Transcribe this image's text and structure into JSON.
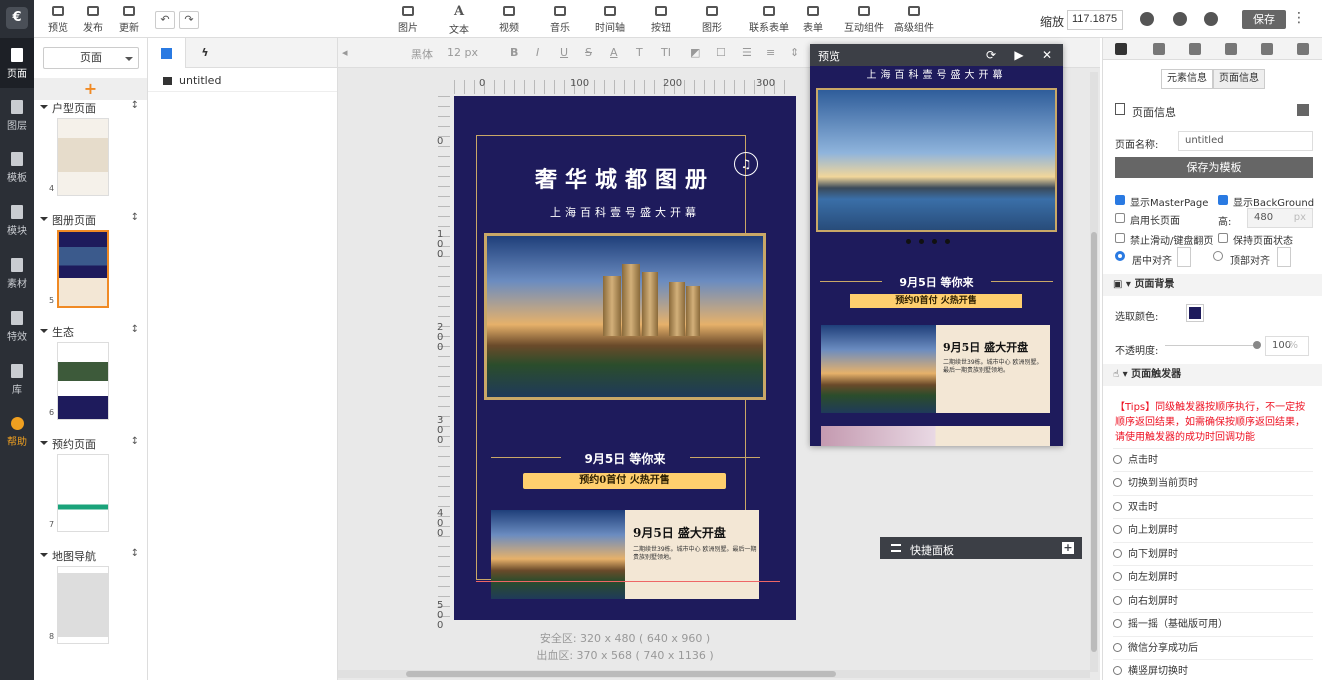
{
  "rail": {
    "logo": "€",
    "items": [
      {
        "label": "页面"
      },
      {
        "label": "图层"
      },
      {
        "label": "模板"
      },
      {
        "label": "模块"
      },
      {
        "label": "素材"
      },
      {
        "label": "特效"
      },
      {
        "label": "库"
      },
      {
        "label": "帮助"
      }
    ]
  },
  "toolbar": {
    "left": [
      {
        "label": "预览"
      },
      {
        "label": "发布"
      },
      {
        "label": "更新"
      }
    ],
    "center": [
      {
        "label": "图片"
      },
      {
        "label": "文本"
      },
      {
        "label": "视频"
      },
      {
        "label": "音乐"
      },
      {
        "label": "时间轴"
      },
      {
        "label": "按钮"
      },
      {
        "label": "图形"
      },
      {
        "label": "联系表单"
      },
      {
        "label": "表单"
      },
      {
        "label": "互动组件"
      },
      {
        "label": "高级组件"
      }
    ],
    "zoom_label": "缩放",
    "zoom_value": "117.1875",
    "save": "保存",
    "text_icon": "A"
  },
  "pages": {
    "select_value": "页面",
    "add": "+",
    "groups": [
      {
        "name": "户型页面",
        "num": "4"
      },
      {
        "name": "图册页面",
        "num": "5"
      },
      {
        "name": "生态",
        "num": "6"
      },
      {
        "name": "预约页面",
        "num": "7"
      },
      {
        "name": "地图导航",
        "num": "8"
      }
    ]
  },
  "layers": {
    "item": "untitled"
  },
  "format": {
    "font": "黑体",
    "size": "12 px",
    "items": [
      "B",
      "I",
      "U",
      "S",
      "A",
      "T",
      "TI"
    ]
  },
  "rulers": {
    "h": [
      "0",
      "100",
      "200",
      "300"
    ],
    "v": [
      "0",
      "1",
      "0",
      "0",
      "2",
      "0",
      "0",
      "3",
      "0",
      "0",
      "4",
      "0",
      "0",
      "5",
      "0",
      "0"
    ]
  },
  "poster": {
    "title": "奢华城都图册",
    "subtitle": "上海百科壹号盛大开幕",
    "music": "♫",
    "date": "9月5日 等你来",
    "pill": "预约0首付  火热开售",
    "card_title": "9月5日 盛大开盘",
    "card_desc": "二期续世39栋。城市中心 欧洲别墅。最后一期贵族别墅领地。"
  },
  "canvas": {
    "safe": "安全区: 320 x 480 ( 640 x 960 )",
    "bleed": "出血区: 370 x 568 ( 740 x 1136 )"
  },
  "preview": {
    "title": "预览",
    "top_text": "上海百科壹号盛大开幕",
    "date": "9月5日 等你来",
    "pill": "预约0首付  火热开售",
    "card_title": "9月5日 盛大开盘",
    "card_desc": "二期续世39栋。城市中心 欧洲别墅。最后一期贵族别墅领地。",
    "icons": [
      "⟳",
      "▶",
      "✕"
    ]
  },
  "quick_panel": {
    "label": "快捷面板",
    "plus": "+"
  },
  "props": {
    "sub_tabs": [
      "元素信息",
      "页面信息"
    ],
    "page_info": "页面信息",
    "name_label": "页面名称:",
    "name_value": "untitled",
    "save_template": "保存为模板",
    "show_master": "显示MasterPage",
    "show_bg": "显示BackGround",
    "long_page": "启用长页面",
    "height_label": "高:",
    "height_value": "480",
    "height_unit": "px",
    "disable_swipe": "禁止滑动/键盘翻页",
    "keep_state": "保持页面状态",
    "center_align": "居中对齐",
    "top_align": "顶部对齐",
    "bg_section": "页面背景",
    "pick_color": "选取颜色:",
    "bg_color": "#1e1b5c",
    "opacity_label": "不透明度:",
    "opacity_value": "100",
    "opacity_unit": "%",
    "trigger_section": "页面触发器",
    "tips": "【Tips】同级触发器按顺序执行，不一定按顺序返回结果，如需确保按顺序返回结果，请使用触发器的成功时回调功能",
    "triggers": [
      "点击时",
      "切换到当前页时",
      "双击时",
      "向上划屏时",
      "向下划屏时",
      "向左划屏时",
      "向右划屏时",
      "摇一摇（基础版可用）",
      "微信分享成功后",
      "横竖屏切换时"
    ]
  }
}
